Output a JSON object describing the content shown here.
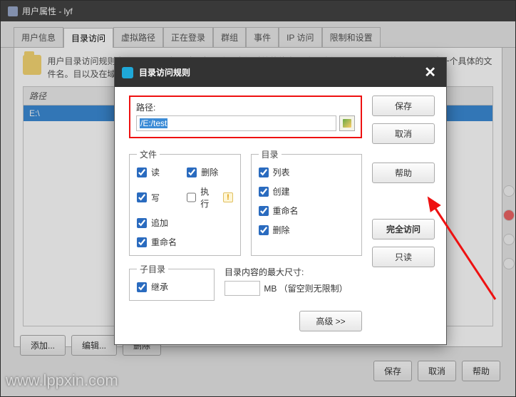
{
  "titlebar": {
    "title": "用户属性 - lyf"
  },
  "tabs": [
    "用户信息",
    "目录访问",
    "虚拟路径",
    "正在登录",
    "群组",
    "事件",
    "IP 访问",
    "限制和设置"
  ],
  "active_tab_index": 1,
  "info_text": "用户目录访问规则定义了一个用户通过服务器访问文件系统的能力。访问路径可以是一个具体的目录，或一个具体的文件名。目以及在域和服务器级别定义的规则",
  "list": {
    "header": "路径",
    "rows": [
      "E:\\"
    ]
  },
  "bottom_buttons": {
    "add": "添加...",
    "edit": "编辑...",
    "delete": "删除"
  },
  "footer_buttons": {
    "save": "保存",
    "cancel": "取消",
    "help": "帮助"
  },
  "watermark": "www.lppxin.com",
  "modal": {
    "title": "目录访问规则",
    "path": {
      "label": "路径:",
      "value": "/E:/test"
    },
    "file_legend": "文件",
    "dir_legend": "目录",
    "subdir_legend": "子目录",
    "file_perms": {
      "read": "读",
      "write": "写",
      "append": "追加",
      "rename": "重命名",
      "delete": "删除",
      "execute": "执行"
    },
    "dir_perms": {
      "list": "列表",
      "create": "创建",
      "rename": "重命名",
      "delete": "删除"
    },
    "subdir": {
      "inherit": "继承"
    },
    "maxsize": {
      "label": "目录内容的最大尺寸:",
      "unit": "MB （留空则无限制）"
    },
    "side": {
      "save": "保存",
      "cancel": "取消",
      "help": "帮助",
      "full": "完全访问",
      "readonly": "只读",
      "advanced": "高级 >>"
    }
  }
}
